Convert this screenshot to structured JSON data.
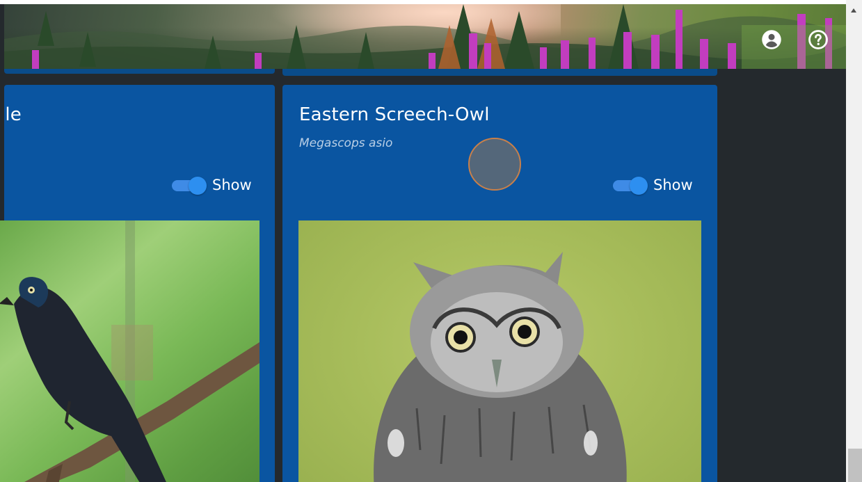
{
  "header": {
    "account_icon": "account-circle-icon",
    "help_icon": "help-circle-icon"
  },
  "cards": [
    {
      "title": "le",
      "subtitle": "",
      "toggle_label": "Show",
      "toggle_on": true,
      "image_subject": "grackle-photo"
    },
    {
      "title": "Eastern Screech-Owl",
      "subtitle": "Megascops asio",
      "toggle_label": "Show",
      "toggle_on": true,
      "image_subject": "screech-owl-photo"
    }
  ],
  "colors": {
    "background": "#24292d",
    "card": "#0a55a1",
    "toggle": "#2d8ff0",
    "text": "#ffffff",
    "subtitle": "#b9cfe6"
  }
}
